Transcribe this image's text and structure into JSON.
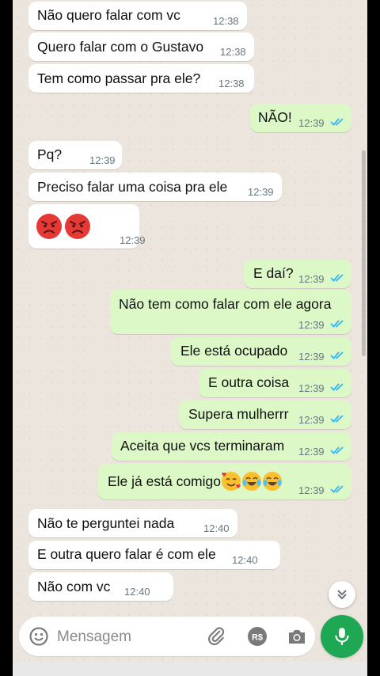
{
  "messages": [
    {
      "dir": "in",
      "text": "Não quero falar com vc",
      "time": "12:38"
    },
    {
      "dir": "in",
      "text": "Quero falar com o Gustavo",
      "time": "12:38"
    },
    {
      "dir": "in",
      "text": "Tem como passar pra ele?",
      "time": "12:38"
    },
    {
      "dir": "out",
      "text": "NÃO!",
      "time": "12:39",
      "status": "read"
    },
    {
      "dir": "in",
      "text": "Pq?",
      "time": "12:39"
    },
    {
      "dir": "in",
      "text": "Preciso falar uma coisa pra ele",
      "time": "12:39"
    },
    {
      "dir": "in",
      "emoji": [
        "angry-face",
        "angry-face"
      ],
      "time": "12:39"
    },
    {
      "dir": "out",
      "text": "E daí?",
      "time": "12:39",
      "status": "read"
    },
    {
      "dir": "out",
      "text": "Não tem como falar com ele agora",
      "time": "12:39",
      "status": "read"
    },
    {
      "dir": "out",
      "text": "Ele está ocupado",
      "time": "12:39",
      "status": "read"
    },
    {
      "dir": "out",
      "text": "E outra coisa",
      "time": "12:39",
      "status": "read"
    },
    {
      "dir": "out",
      "text": "Supera mulherrr",
      "time": "12:39",
      "status": "read"
    },
    {
      "dir": "out",
      "text": "Aceita que vcs terminaram",
      "time": "12:39",
      "status": "read"
    },
    {
      "dir": "out",
      "text": "Ele já está comigo",
      "emoji": [
        "smiling-face-with-hearts",
        "tears-of-joy-face",
        "tears-of-joy-face"
      ],
      "time": "12:39",
      "status": "read"
    },
    {
      "dir": "in",
      "text": "Não te perguntei nada",
      "time": "12:40"
    },
    {
      "dir": "in",
      "text": "E outra quero falar é com ele",
      "time": "12:40"
    },
    {
      "dir": "in",
      "text": "Não com vc",
      "time": "12:40"
    }
  ],
  "composer": {
    "placeholder": "Mensagem",
    "icons": [
      "emoji-icon",
      "attach-icon",
      "payment-icon",
      "camera-icon"
    ]
  },
  "colors": {
    "incoming": "#ffffff",
    "outgoing": "#dcf8c6",
    "chat_background": "#ece5dd",
    "read_ticks": "#34b7f1",
    "mic_button": "#1ea854"
  }
}
